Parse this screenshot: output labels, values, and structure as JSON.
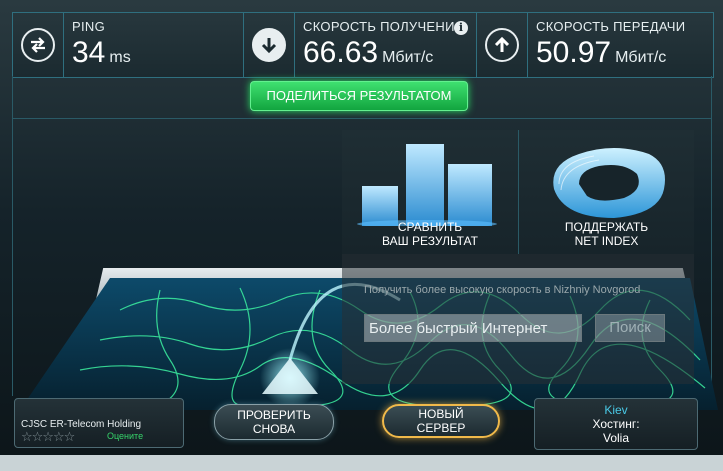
{
  "header": {
    "ping": {
      "label": "PING",
      "value": "34",
      "unit": "ms"
    },
    "download": {
      "label": "СКОРОСТЬ ПОЛУЧЕНИЯ",
      "value": "66.63",
      "unit": "Мбит/с"
    },
    "upload": {
      "label": "СКОРОСТЬ ПЕРЕДАЧИ",
      "value": "50.97",
      "unit": "Мбит/с"
    },
    "info_glyph": "i"
  },
  "share_button": "ПОДЕЛИТЬСЯ РЕЗУЛЬТАТОМ",
  "tiles": {
    "compare": {
      "line1": "СРАВНИТЬ",
      "line2": "ВАШ РЕЗУЛЬТАТ"
    },
    "support": {
      "line1": "ПОДДЕРЖАТЬ",
      "line2": "NET INDEX"
    }
  },
  "promo": {
    "text": "Получить более высокую скорость в Nizhniy Novgorod",
    "search_value": "Более быстрый Интернет",
    "search_button": "Поиск"
  },
  "isp": {
    "name": "CJSC ER-Telecom Holding",
    "stars": "☆☆☆☆☆",
    "rate_link": "Оцените"
  },
  "buttons": {
    "retry": {
      "line1": "ПРОВЕРИТЬ",
      "line2": "СНОВА"
    },
    "new_server": {
      "line1": "НОВЫЙ",
      "line2": "СЕРВЕР"
    }
  },
  "server": {
    "city": "Kiev",
    "hosting_label": "Хостинг:",
    "host": "Volia"
  },
  "colors": {
    "accent_green": "#28e064",
    "accent_orange": "#f0b94a",
    "accent_blue": "#49c9e6",
    "map_line": "#3cf0a0"
  }
}
